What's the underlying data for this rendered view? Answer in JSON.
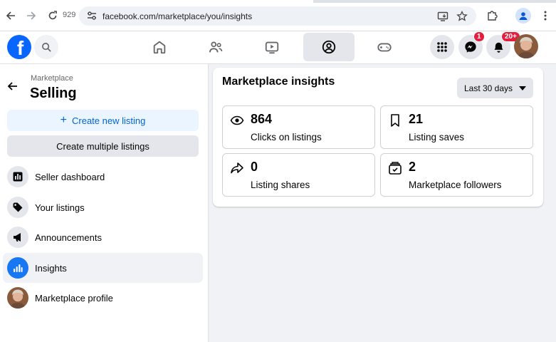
{
  "browser": {
    "reload_count": "929",
    "url": "facebook.com/marketplace/you/insights"
  },
  "header": {
    "logo_letter": "f",
    "messenger_badge": "1",
    "notifications_badge": "20+",
    "active_tab": "marketplace"
  },
  "sidebar": {
    "breadcrumb": "Marketplace",
    "title": "Selling",
    "create_listing": "Create new listing",
    "create_multiple": "Create multiple listings",
    "items": [
      {
        "label": "Seller dashboard",
        "icon": "dashboard-icon"
      },
      {
        "label": "Your listings",
        "icon": "tag-icon"
      },
      {
        "label": "Announcements",
        "icon": "megaphone-icon"
      },
      {
        "label": "Insights",
        "icon": "bar-chart-icon",
        "active": true
      },
      {
        "label": "Marketplace profile",
        "icon": "avatar"
      }
    ]
  },
  "main": {
    "title": "Marketplace insights",
    "date_range": "Last 30 days",
    "stats": [
      {
        "value": "864",
        "label": "Clicks on listings",
        "icon": "eye-icon"
      },
      {
        "value": "21",
        "label": "Listing saves",
        "icon": "bookmark-icon"
      },
      {
        "value": "0",
        "label": "Listing shares",
        "icon": "share-icon"
      },
      {
        "value": "2",
        "label": "Marketplace followers",
        "icon": "followers-icon"
      }
    ]
  },
  "colors": {
    "brand": "#0866ff",
    "badge": "#e41e3f",
    "accent_text": "#0064d1"
  }
}
